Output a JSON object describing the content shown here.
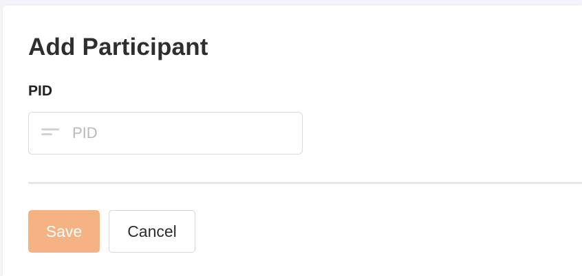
{
  "form": {
    "title": "Add Participant",
    "pid_field": {
      "label": "PID",
      "placeholder": "PID",
      "value": "",
      "icon": "text-lines-icon"
    },
    "save_label": "Save",
    "cancel_label": "Cancel"
  },
  "colors": {
    "save_button_bg": "#f5b383",
    "page_bg": "#f4f4f8"
  }
}
